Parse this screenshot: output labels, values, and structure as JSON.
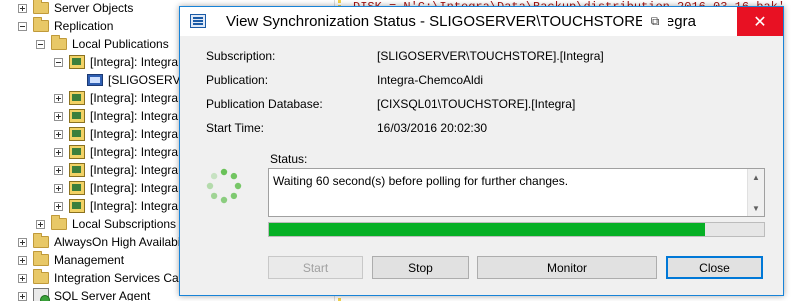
{
  "tree": {
    "items": [
      {
        "label": "Server Objects",
        "expander": "plus",
        "icon": "folder-icon"
      },
      {
        "label": "Replication",
        "expander": "minus",
        "icon": "folder-icon"
      },
      {
        "label": "Local Publications",
        "expander": "minus",
        "icon": "folder-icon"
      },
      {
        "label": "[Integra]: Integra",
        "expander": "minus",
        "icon": "publication-icon"
      },
      {
        "label": "[SLIGOSERVE",
        "expander": "none",
        "icon": "subscription-icon"
      },
      {
        "label": "[Integra]: Integra",
        "expander": "plus",
        "icon": "publication-icon"
      },
      {
        "label": "[Integra]: Integra",
        "expander": "plus",
        "icon": "publication-icon"
      },
      {
        "label": "[Integra]: Integra",
        "expander": "plus",
        "icon": "publication-icon"
      },
      {
        "label": "[Integra]: Integra",
        "expander": "plus",
        "icon": "publication-icon"
      },
      {
        "label": "[Integra]: Integra",
        "expander": "plus",
        "icon": "publication-icon"
      },
      {
        "label": "[Integra]: Integra",
        "expander": "plus",
        "icon": "publication-icon"
      },
      {
        "label": "[Integra]: Integra",
        "expander": "plus",
        "icon": "publication-icon"
      },
      {
        "label": "Local Subscriptions",
        "expander": "plus",
        "icon": "folder-icon"
      },
      {
        "label": "AlwaysOn High Availabi",
        "expander": "plus",
        "icon": "folder-icon"
      },
      {
        "label": "Management",
        "expander": "plus",
        "icon": "folder-icon"
      },
      {
        "label": "Integration Services Cata",
        "expander": "plus",
        "icon": "folder-icon"
      },
      {
        "label": "SQL Server Agent",
        "expander": "plus",
        "icon": "agent-icon"
      }
    ]
  },
  "editor": {
    "code_line": "DISK = N'C:\\Integra\\Data\\Backup\\distribution_2016-03-16.bak'"
  },
  "dialog": {
    "title": "View Synchronization Status - SLIGOSERVER\\TOUCHSTORE:Integra",
    "fields": [
      {
        "label": "Subscription:",
        "value": "[SLIGOSERVER\\TOUCHSTORE].[Integra]"
      },
      {
        "label": "Publication:",
        "value": "Integra-ChemcoAldi"
      },
      {
        "label": "Publication Database:",
        "value": "[CIXSQL01\\TOUCHSTORE].[Integra]"
      },
      {
        "label": "Start Time:",
        "value": "16/03/2016 20:02:30"
      }
    ],
    "status_label": "Status:",
    "status_text": "Waiting 60 second(s) before polling for further changes.",
    "progress_fraction": 0.88,
    "buttons": {
      "start": "Start",
      "stop": "Stop",
      "monitor": "Monitor",
      "close": "Close"
    },
    "icons": {
      "restore": "restore-icon",
      "close": "close-icon"
    }
  },
  "colors": {
    "progress_fill": "#06b025",
    "title_close_bg": "#e81123",
    "dialog_border": "#1883d7"
  }
}
